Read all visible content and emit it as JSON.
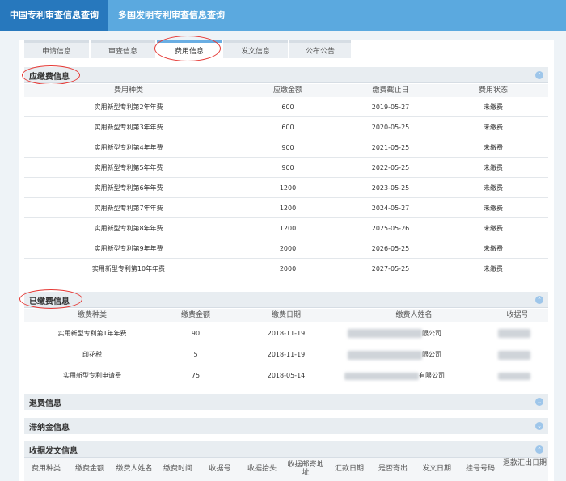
{
  "top_nav": {
    "active": "中国专利审查信息查询",
    "second": "多国发明专利审查信息查询"
  },
  "tabs": [
    {
      "label": "申请信息"
    },
    {
      "label": "审查信息"
    },
    {
      "label": "费用信息"
    },
    {
      "label": "发文信息"
    },
    {
      "label": "公布公告"
    }
  ],
  "fee_due": {
    "title": "应缴费信息",
    "columns": [
      "费用种类",
      "应缴金额",
      "缴费截止日",
      "费用状态"
    ],
    "rows": [
      [
        "实用新型专利第2年年费",
        "600",
        "2019-05-27",
        "未缴费"
      ],
      [
        "实用新型专利第3年年费",
        "600",
        "2020-05-25",
        "未缴费"
      ],
      [
        "实用新型专利第4年年费",
        "900",
        "2021-05-25",
        "未缴费"
      ],
      [
        "实用新型专利第5年年费",
        "900",
        "2022-05-25",
        "未缴费"
      ],
      [
        "实用新型专利第6年年费",
        "1200",
        "2023-05-25",
        "未缴费"
      ],
      [
        "实用新型专利第7年年费",
        "1200",
        "2024-05-27",
        "未缴费"
      ],
      [
        "实用新型专利第8年年费",
        "1200",
        "2025-05-26",
        "未缴费"
      ],
      [
        "实用新型专利第9年年费",
        "2000",
        "2026-05-25",
        "未缴费"
      ],
      [
        "实用新型专利第10年年费",
        "2000",
        "2027-05-25",
        "未缴费"
      ]
    ]
  },
  "fee_paid": {
    "title": "已缴费信息",
    "columns": [
      "缴费种类",
      "缴费金额",
      "缴费日期",
      "缴费人姓名",
      "收据号"
    ],
    "rows": [
      [
        "实用新型专利第1年年费",
        "90",
        "2018-11-19",
        "限公司",
        ""
      ],
      [
        "印花税",
        "5",
        "2018-11-19",
        "限公司",
        ""
      ],
      [
        "实用新型专利申请费",
        "75",
        "2018-05-14",
        "有限公司",
        ""
      ]
    ]
  },
  "refund": {
    "title": "退费信息"
  },
  "late_fee": {
    "title": "滞纳金信息"
  },
  "receipt": {
    "title": "收据发文信息",
    "columns": [
      "费用种类",
      "缴费金额",
      "缴费人姓名",
      "缴费时间",
      "收据号",
      "收据抬头",
      "收据邮寄地址",
      "汇款日期",
      "是否寄出",
      "发文日期",
      "挂号号码",
      "退款汇出日期"
    ]
  },
  "colors": {
    "top_bar": "#5ba9df",
    "top_active": "#2778bd",
    "highlight_oval": "#e53935"
  }
}
